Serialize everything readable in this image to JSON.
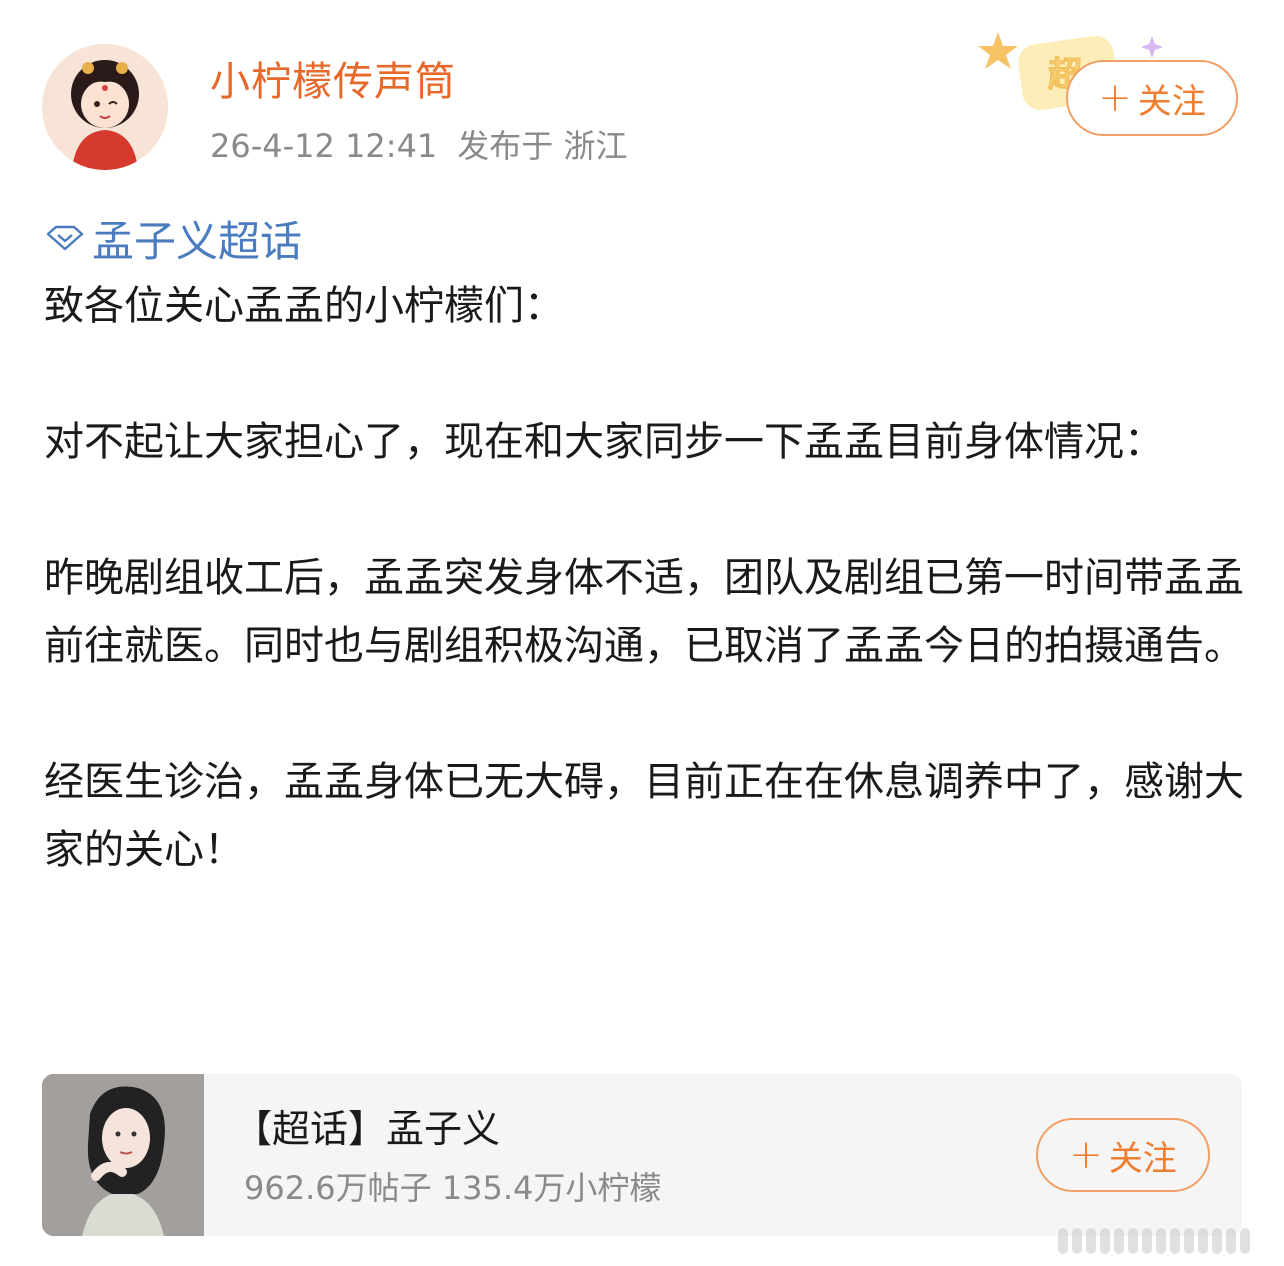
{
  "header": {
    "username": "小柠檬传声筒",
    "timestamp": "26-4-12 12:41",
    "location": "发布于 浙江",
    "badge_text": "超",
    "follow_label": "关注",
    "follow_icon": "plus-icon"
  },
  "post": {
    "topic": "孟子义超话",
    "topic_icon": "supertopic-diamond-icon",
    "paragraphs": [
      "致各位关心孟孟的小柠檬们：",
      "对不起让大家担心了，现在和大家同步一下孟孟目前身体情况：",
      "昨晚剧组收工后，孟孟突发身体不适，团队及剧组已第一时间带孟孟前往就医。同时也与剧组积极沟通，已取消了孟孟今日的拍摄通告。",
      "经医生诊治，孟孟身体已无大碍，目前正在在休息调养中了，感谢大家的关心！"
    ]
  },
  "card": {
    "title": "【超话】孟子义",
    "stats": "962.6万帖子 135.4万小柠檬",
    "follow_label": "关注",
    "follow_icon": "plus-icon"
  },
  "colors": {
    "username": "#e8682a",
    "link": "#4a7cbf",
    "follow": "#ef7e32",
    "follow_border": "#f0a066",
    "meta": "#8a8a8a",
    "card_bg": "#f5f5f5"
  }
}
